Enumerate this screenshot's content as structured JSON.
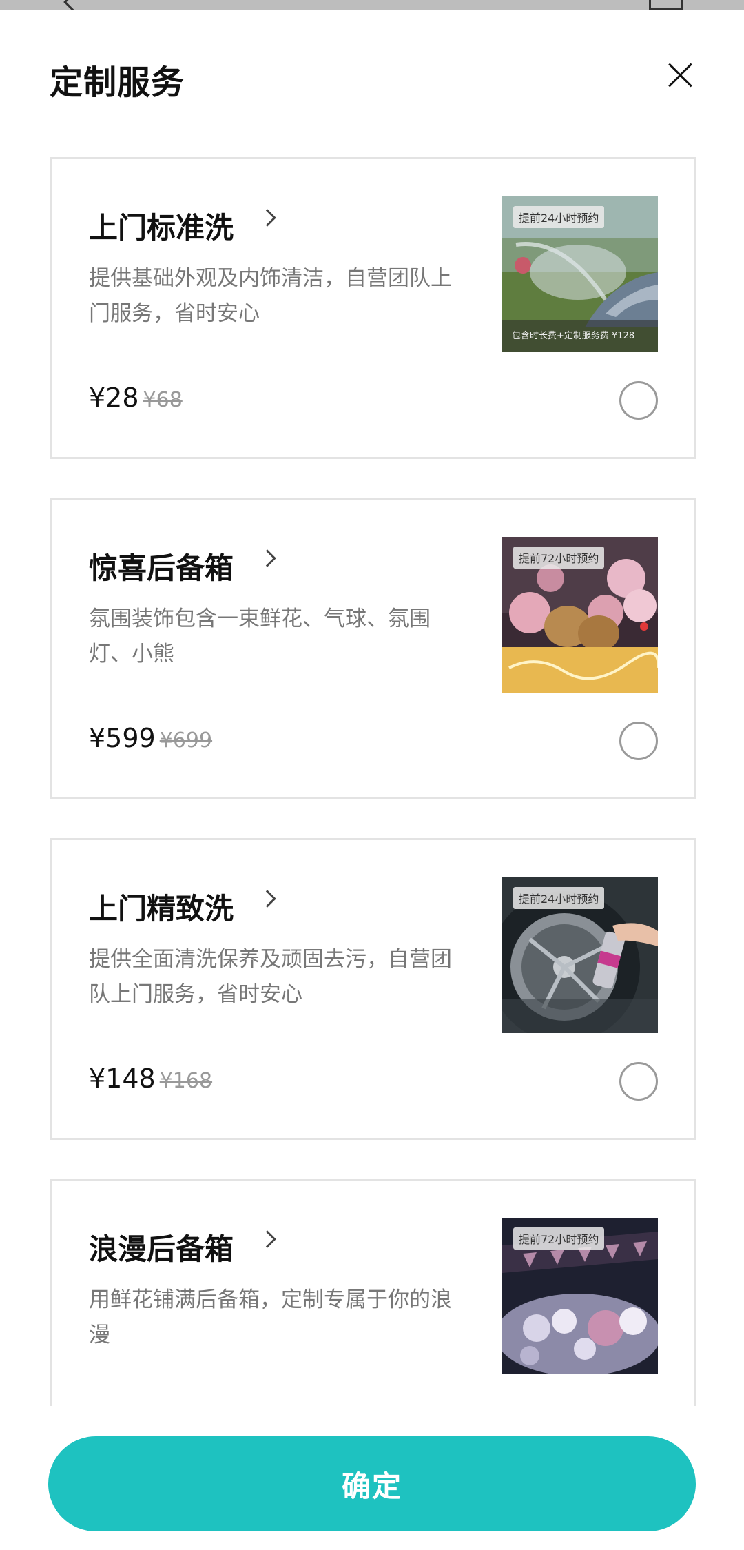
{
  "sheet": {
    "title": "定制服务",
    "confirm_label": "确定"
  },
  "services": [
    {
      "name": "上门标准洗",
      "desc": "提供基础外观及内饰清洁，自营团队上门服务，省时安心",
      "price": "¥28",
      "original_price": "¥68",
      "image_tag": "提前24小时预约",
      "image_footer": "包含时长费+定制服务费 ¥128",
      "selected": false
    },
    {
      "name": "惊喜后备箱",
      "desc": "氛围装饰包含一束鲜花、气球、氛围灯、小熊",
      "price": "¥599",
      "original_price": "¥699",
      "image_tag": "提前72小时预约",
      "selected": false
    },
    {
      "name": "上门精致洗",
      "desc": "提供全面清洗保养及顽固去污，自营团队上门服务，省时安心",
      "price": "¥148",
      "original_price": "¥168",
      "image_tag": "提前24小时预约",
      "selected": false
    },
    {
      "name": "浪漫后备箱",
      "desc": "用鲜花铺满后备箱，定制专属于你的浪漫",
      "image_tag": "提前72小时预约",
      "selected": false
    }
  ],
  "colors": {
    "accent": "#1ec2c0",
    "card_border": "#e3e3e3"
  }
}
